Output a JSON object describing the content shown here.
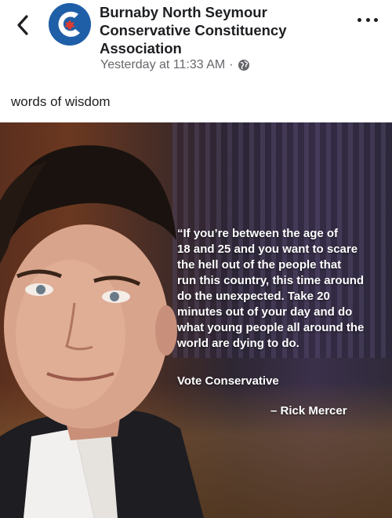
{
  "header": {
    "page_name_lines": [
      "Burnaby North Seymour",
      "Conservative Constituency",
      "Association"
    ],
    "timestamp": "Yesterday at 11:33 AM",
    "separator": "·",
    "privacy_icon": "globe-icon",
    "back_icon": "chevron-left-icon",
    "more_icon": "more-dots-icon",
    "avatar_colors": {
      "ring": "#1f5fa8",
      "flame": "#e03a2f"
    }
  },
  "post": {
    "caption": "words of wisdom"
  },
  "image": {
    "quote_lines": [
      "“If you’re between the age of",
      "18 and 25 and you want to scare",
      "the hell out of the people that",
      "run this country, this time around",
      "do the unexpected. Take 20",
      "minutes out of your day and do",
      "what young people all around the",
      "world are dying to do."
    ],
    "vote_text": "Vote Conservative",
    "attribution": "– Rick Mercer"
  }
}
